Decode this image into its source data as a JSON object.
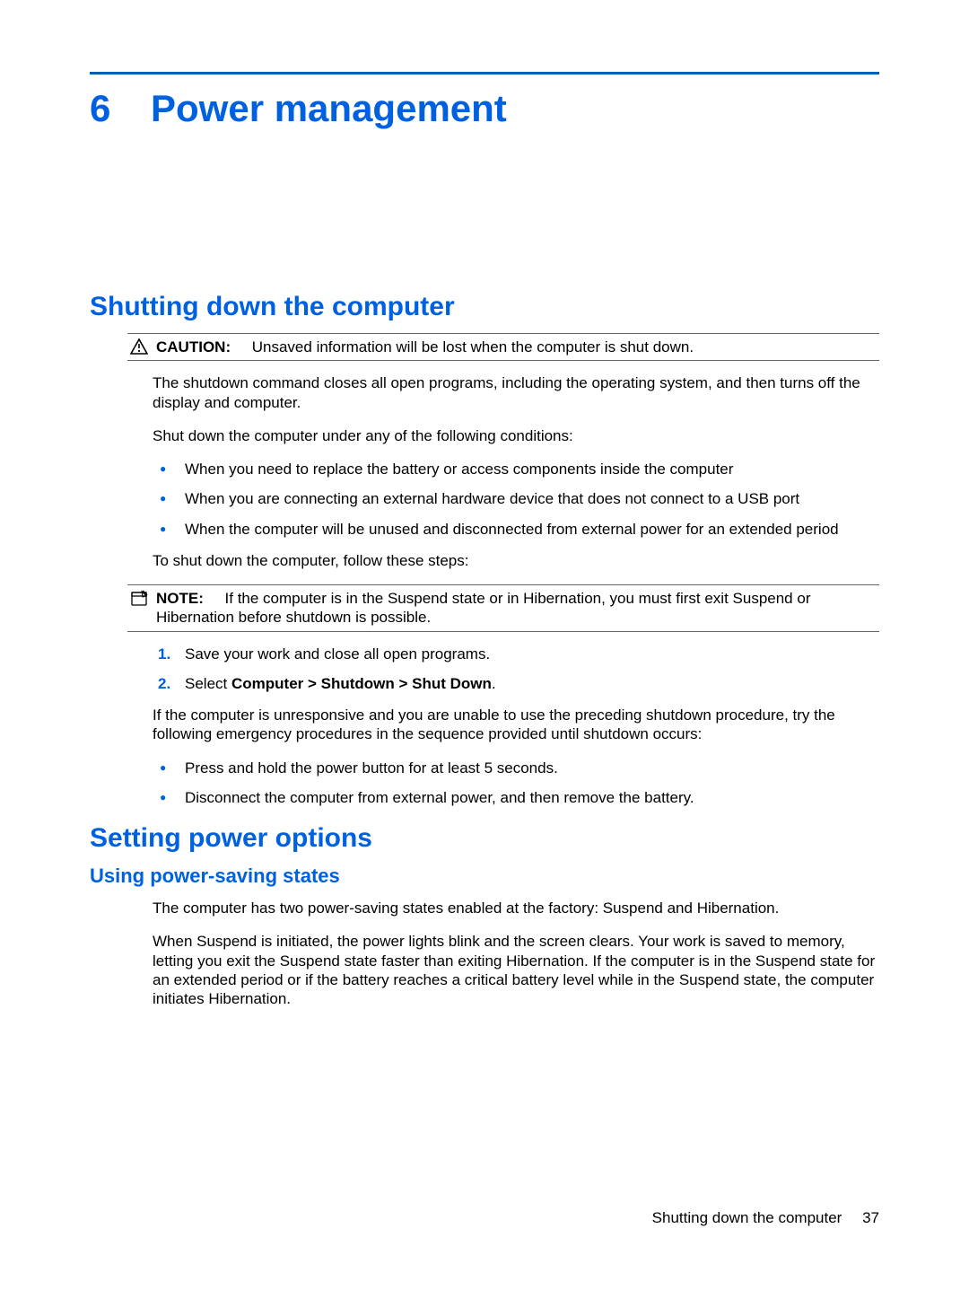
{
  "chapter": {
    "number": "6",
    "title": "Power management"
  },
  "section1": {
    "title": "Shutting down the computer",
    "caution": {
      "label": "CAUTION:",
      "text": "Unsaved information will be lost when the computer is shut down."
    },
    "p1": "The shutdown command closes all open programs, including the operating system, and then turns off the display and computer.",
    "p2": "Shut down the computer under any of the following conditions:",
    "bullets1": [
      "When you need to replace the battery or access components inside the computer",
      "When you are connecting an external hardware device that does not connect to a USB port",
      "When the computer will be unused and disconnected from external power for an extended period"
    ],
    "p3": "To shut down the computer, follow these steps:",
    "note": {
      "label": "NOTE:",
      "text": "If the computer is in the Suspend state or in Hibernation, you must first exit Suspend or Hibernation before shutdown is possible."
    },
    "steps": [
      {
        "text": "Save your work and close all open programs."
      },
      {
        "prefix": "Select ",
        "bold": "Computer > Shutdown > Shut Down",
        "suffix": "."
      }
    ],
    "p4": "If the computer is unresponsive and you are unable to use the preceding shutdown procedure, try the following emergency procedures in the sequence provided until shutdown occurs:",
    "bullets2": [
      "Press and hold the power button for at least 5 seconds.",
      "Disconnect the computer from external power, and then remove the battery."
    ]
  },
  "section2": {
    "title": "Setting power options",
    "sub1": {
      "title": "Using power-saving states",
      "p1": "The computer has two power-saving states enabled at the factory: Suspend and Hibernation.",
      "p2": "When Suspend is initiated, the power lights blink and the screen clears. Your work is saved to memory, letting you exit the Suspend state faster than exiting Hibernation. If the computer is in the Suspend state for an extended period or if the battery reaches a critical battery level while in the Suspend state, the computer initiates Hibernation."
    }
  },
  "footer": {
    "section": "Shutting down the computer",
    "page": "37"
  }
}
